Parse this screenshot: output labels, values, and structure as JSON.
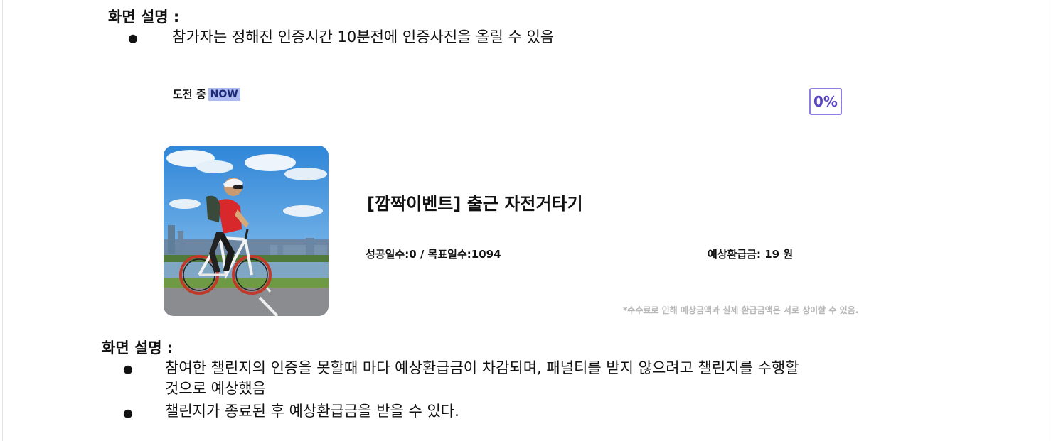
{
  "section1": {
    "heading": "화면 설명 :",
    "bullets": [
      "참가자는 정해진 인증시간 10분전에 인증사진을 올릴 수 있음"
    ]
  },
  "challenge": {
    "status_label": "도전 중",
    "status_badge": "NOW",
    "progress_percent": "0%",
    "title": "[깜짝이벤트] 출근 자전거타기",
    "stats": "성공일수:0 / 목표일수:1094",
    "expected_refund": "예상환급금: 19 원",
    "notice": "*수수료로 인해 예상금액과 실제 환급금액은 서로 상이할 수 있음."
  },
  "section2": {
    "heading": "화면 설명 :",
    "bullets": [
      {
        "line1": "참여한 챌린지의 인증을 못할때 마다 예상환급금이 차감되며, 패널티를 받지 않으려고 챌린지를 수행할",
        "line2": "것으로 예상했음"
      },
      {
        "line1": "챌린지가 종료된 후 예상환급금을 받을 수 있다."
      }
    ]
  },
  "colors": {
    "badge_bg": "#aebcf2",
    "percent_border": "#8d7fe2",
    "notice_text": "#b7b7b7"
  },
  "icons": {
    "bullet": "filled-circle",
    "photo": "cyclist-photo"
  }
}
